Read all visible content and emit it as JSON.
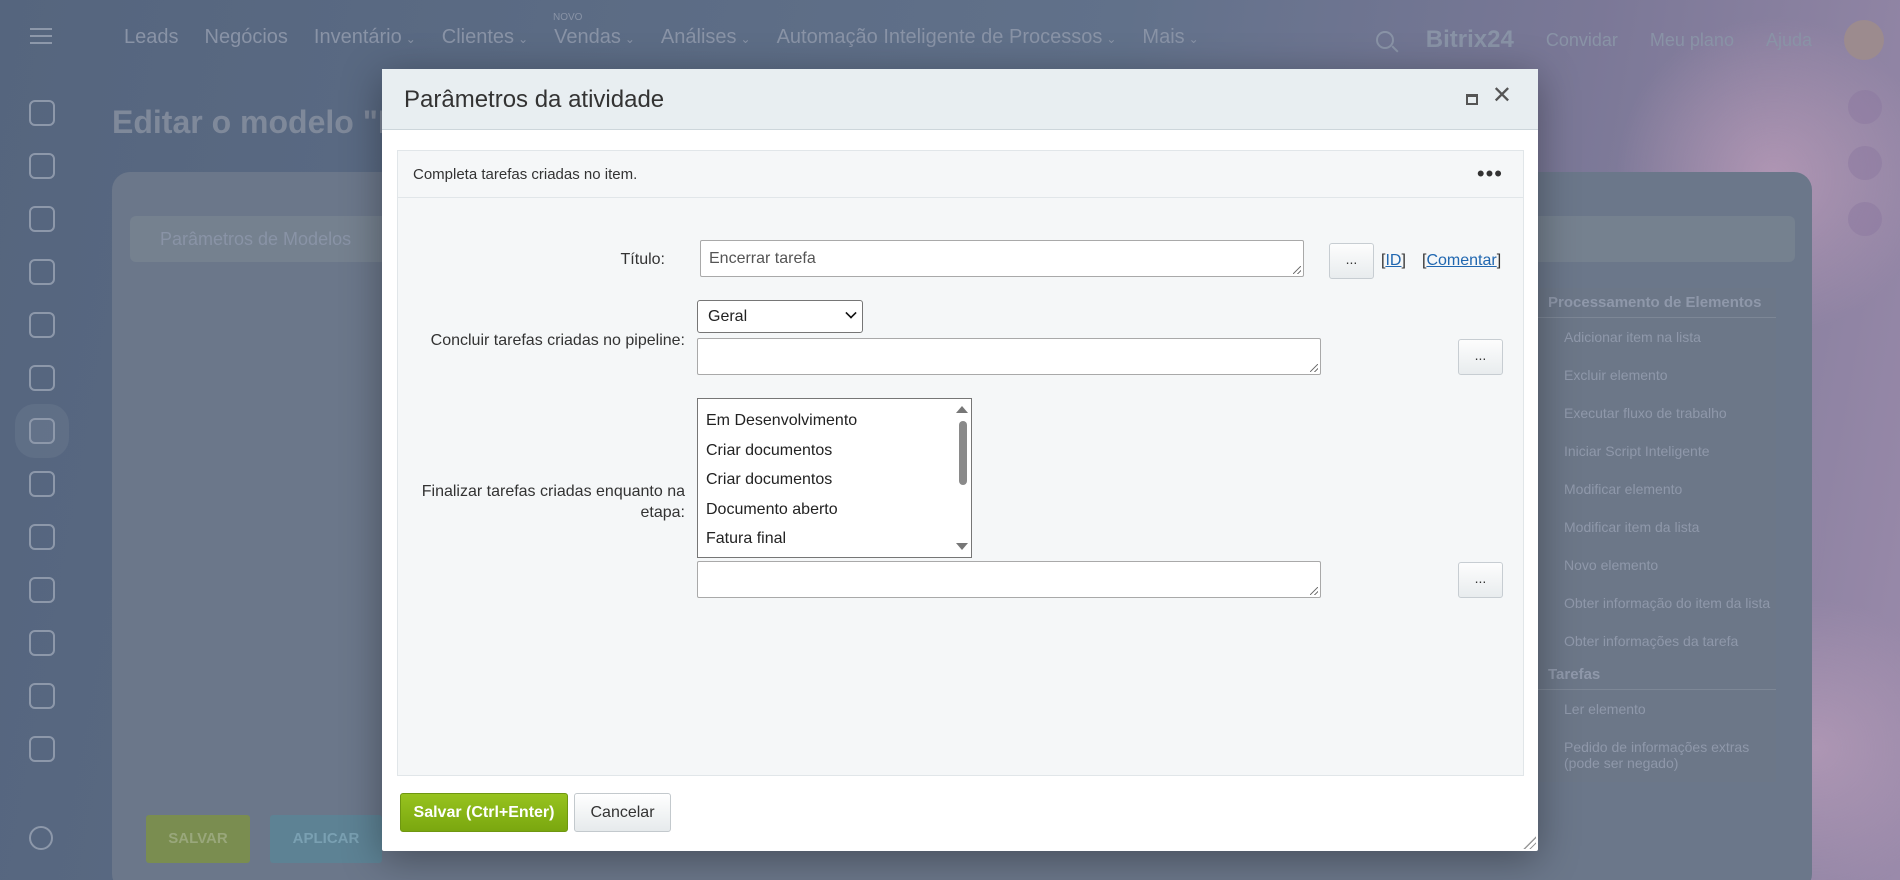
{
  "background": {
    "nav": [
      "Leads",
      "Negócios",
      "Inventário",
      "Clientes",
      "Vendas",
      "Análises",
      "Automação Inteligente de Processos",
      "Mais"
    ],
    "nav_badge": "NOVO",
    "brand": "Bitrix24",
    "top_links": [
      "Convidar",
      "Meu plano",
      "Ajuda"
    ],
    "page_title": "Editar o modelo \"N",
    "tab_label": "Parâmetros de Modelos",
    "side_sections": [
      {
        "title": "Processamento de Elementos",
        "items": [
          "Adicionar item na lista",
          "Excluir elemento",
          "Executar fluxo de trabalho",
          "Iniciar Script Inteligente",
          "Modificar elemento",
          "Modificar item da lista",
          "Novo elemento",
          "Obter informação do item da lista",
          "Obter informações da tarefa"
        ]
      },
      {
        "title": "Tarefas",
        "items": [
          "Ler elemento",
          "Pedido de informações extras (pode ser negado)"
        ]
      }
    ],
    "save_label": "SALVAR",
    "apply_label": "APLICAR"
  },
  "dialog": {
    "title": "Parâmetros da atividade",
    "description": "Completa tarefas criadas no item.",
    "more_label": "•••",
    "fields": {
      "title_label": "Título:",
      "title_value": "Encerrar tarefa",
      "title_dots": "...",
      "id_link": "ID",
      "comment_link": "Comentar",
      "pipeline_label": "Concluir tarefas criadas no pipeline:",
      "pipeline_select": "Geral",
      "pipeline_value": "",
      "pipeline_dots": "...",
      "stage_label": "Finalizar tarefas criadas enquanto na etapa:",
      "stage_options": [
        "Em Desenvolvimento",
        "Criar documentos",
        "Criar documentos",
        "Documento aberto",
        "Fatura final"
      ],
      "stage_value": "",
      "stage_dots": "..."
    },
    "save_label": "Salvar (Ctrl+Enter)",
    "cancel_label": "Cancelar"
  },
  "colors": {
    "save_green": "#8cb81a",
    "link_blue": "#2067b0",
    "overlay": "#5b6b82"
  }
}
